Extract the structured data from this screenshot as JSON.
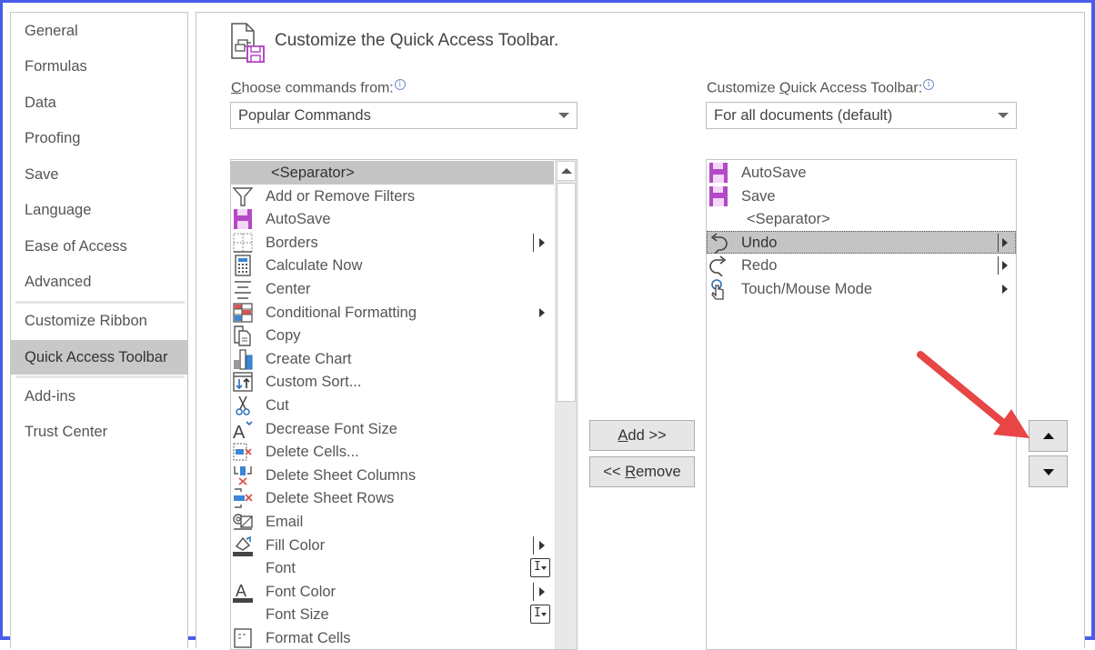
{
  "sidebar": {
    "items": [
      {
        "label": "General"
      },
      {
        "label": "Formulas"
      },
      {
        "label": "Data"
      },
      {
        "label": "Proofing"
      },
      {
        "label": "Save"
      },
      {
        "label": "Language"
      },
      {
        "label": "Ease of Access"
      },
      {
        "label": "Advanced"
      },
      {
        "label": "Customize Ribbon"
      },
      {
        "label": "Quick Access Toolbar",
        "selected": true
      },
      {
        "label": "Add-ins"
      },
      {
        "label": "Trust Center"
      }
    ]
  },
  "header": {
    "title": "Customize the Quick Access Toolbar.",
    "icon": "quick-access-toolbar-customize-icon"
  },
  "left_panel": {
    "label_prefix_underlined": "C",
    "label_rest": "hoose commands from:",
    "info_glyph": "i",
    "select_value": "Popular Commands",
    "items": [
      {
        "label": "<Separator>",
        "icon": "none",
        "selected": true
      },
      {
        "label": "Add or Remove Filters",
        "icon": "filter-icon"
      },
      {
        "label": "AutoSave",
        "icon": "save-disk-icon"
      },
      {
        "label": "Borders",
        "icon": "borders-icon",
        "indicator": "split-submenu"
      },
      {
        "label": "Calculate Now",
        "icon": "calculator-icon"
      },
      {
        "label": "Center",
        "icon": "align-center-icon"
      },
      {
        "label": "Conditional Formatting",
        "icon": "conditional-formatting-icon",
        "indicator": "submenu"
      },
      {
        "label": "Copy",
        "icon": "copy-icon"
      },
      {
        "label": "Create Chart",
        "icon": "chart-icon"
      },
      {
        "label": "Custom Sort...",
        "icon": "sort-icon"
      },
      {
        "label": "Cut",
        "icon": "scissors-icon"
      },
      {
        "label": "Decrease Font Size",
        "icon": "decrease-font-size-icon"
      },
      {
        "label": "Delete Cells...",
        "icon": "delete-cells-icon"
      },
      {
        "label": "Delete Sheet Columns",
        "icon": "delete-columns-icon"
      },
      {
        "label": "Delete Sheet Rows",
        "icon": "delete-rows-icon"
      },
      {
        "label": "Email",
        "icon": "email-icon"
      },
      {
        "label": "Fill Color",
        "icon": "fill-color-icon",
        "indicator": "split-submenu"
      },
      {
        "label": "Font",
        "icon": "none",
        "indicator": "combo"
      },
      {
        "label": "Font Color",
        "icon": "font-color-icon",
        "indicator": "split-submenu"
      },
      {
        "label": "Font Size",
        "icon": "none",
        "indicator": "combo"
      },
      {
        "label": "Format Cells",
        "icon": "format-cells-icon"
      }
    ]
  },
  "right_panel": {
    "label_prefix": "Customize ",
    "label_underlined": "Q",
    "label_rest": "uick Access Toolbar:",
    "info_glyph": "i",
    "select_value": "For all documents (default)",
    "items": [
      {
        "label": "AutoSave",
        "icon": "save-disk-icon"
      },
      {
        "label": "Save",
        "icon": "save-disk-icon"
      },
      {
        "label": "<Separator>",
        "icon": "none"
      },
      {
        "label": "Undo",
        "icon": "undo-icon",
        "indicator": "split-submenu",
        "selected": true
      },
      {
        "label": "Redo",
        "icon": "redo-icon",
        "indicator": "split-submenu"
      },
      {
        "label": "Touch/Mouse Mode",
        "icon": "touch-mode-icon",
        "indicator": "submenu"
      }
    ]
  },
  "buttons": {
    "add_underlined": "A",
    "add_rest": "dd >>",
    "remove_prefix": "<< ",
    "remove_underlined": "R",
    "remove_rest": "emove",
    "move_up": "move-up",
    "move_down": "move-down"
  },
  "annotation": {
    "type": "red-arrow",
    "color": "#e84545",
    "points_to": "move-up-button"
  },
  "colors": {
    "accent_purple": "#b548c6",
    "selection_gray": "#c4c4c4",
    "frame_blue": "#4a5de8"
  }
}
